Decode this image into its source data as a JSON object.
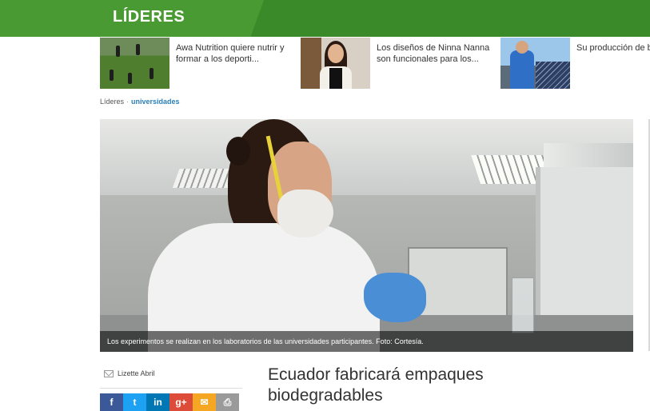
{
  "header": {
    "logo": "LÍDERES"
  },
  "related": [
    {
      "text": "Awa Nutrition quiere nutrir y formar a los deporti..."
    },
    {
      "text": "Los diseños de Ninna Nanna son funcionales para los..."
    },
    {
      "text": "Su producción de b orgánico usa energ"
    }
  ],
  "breadcrumb": {
    "home": "Líderes",
    "separator": "·",
    "current": "universidades"
  },
  "hero": {
    "caption": "Los experimentos se realizan en los laboratorios de las universidades participantes. Foto: Cortesía."
  },
  "author": {
    "name": "Lizette Abril"
  },
  "share": {
    "facebook": "f",
    "twitter": "t",
    "linkedin": "in",
    "googleplus": "g+",
    "mail": "✉",
    "print": "⎙"
  },
  "article": {
    "headline": "Ecuador fabricará empaques biodegradables"
  },
  "colors": {
    "header_green": "#3b8a2a",
    "breadcrumb_link": "#2d7fb8"
  }
}
